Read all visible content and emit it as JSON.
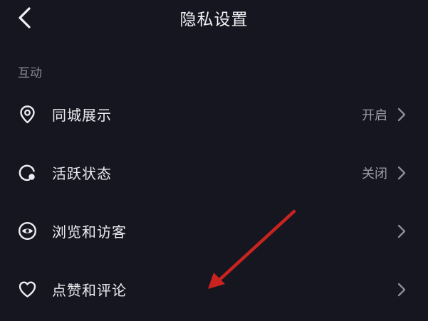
{
  "header": {
    "title": "隐私设置",
    "back_icon": "chevron-left-icon"
  },
  "section": {
    "label": "互动"
  },
  "rows": [
    {
      "label": "同城展示",
      "value": "开启",
      "icon": "location-pin-icon"
    },
    {
      "label": "活跃状态",
      "value": "关闭",
      "icon": "activity-status-icon"
    },
    {
      "label": "浏览和访客",
      "value": "",
      "icon": "eye-icon"
    },
    {
      "label": "点赞和评论",
      "value": "",
      "icon": "heart-icon"
    }
  ],
  "colors": {
    "background": "#15161f",
    "text": "#ececf1",
    "muted": "#9a9ba5",
    "annotation_arrow": "#c8231f"
  }
}
